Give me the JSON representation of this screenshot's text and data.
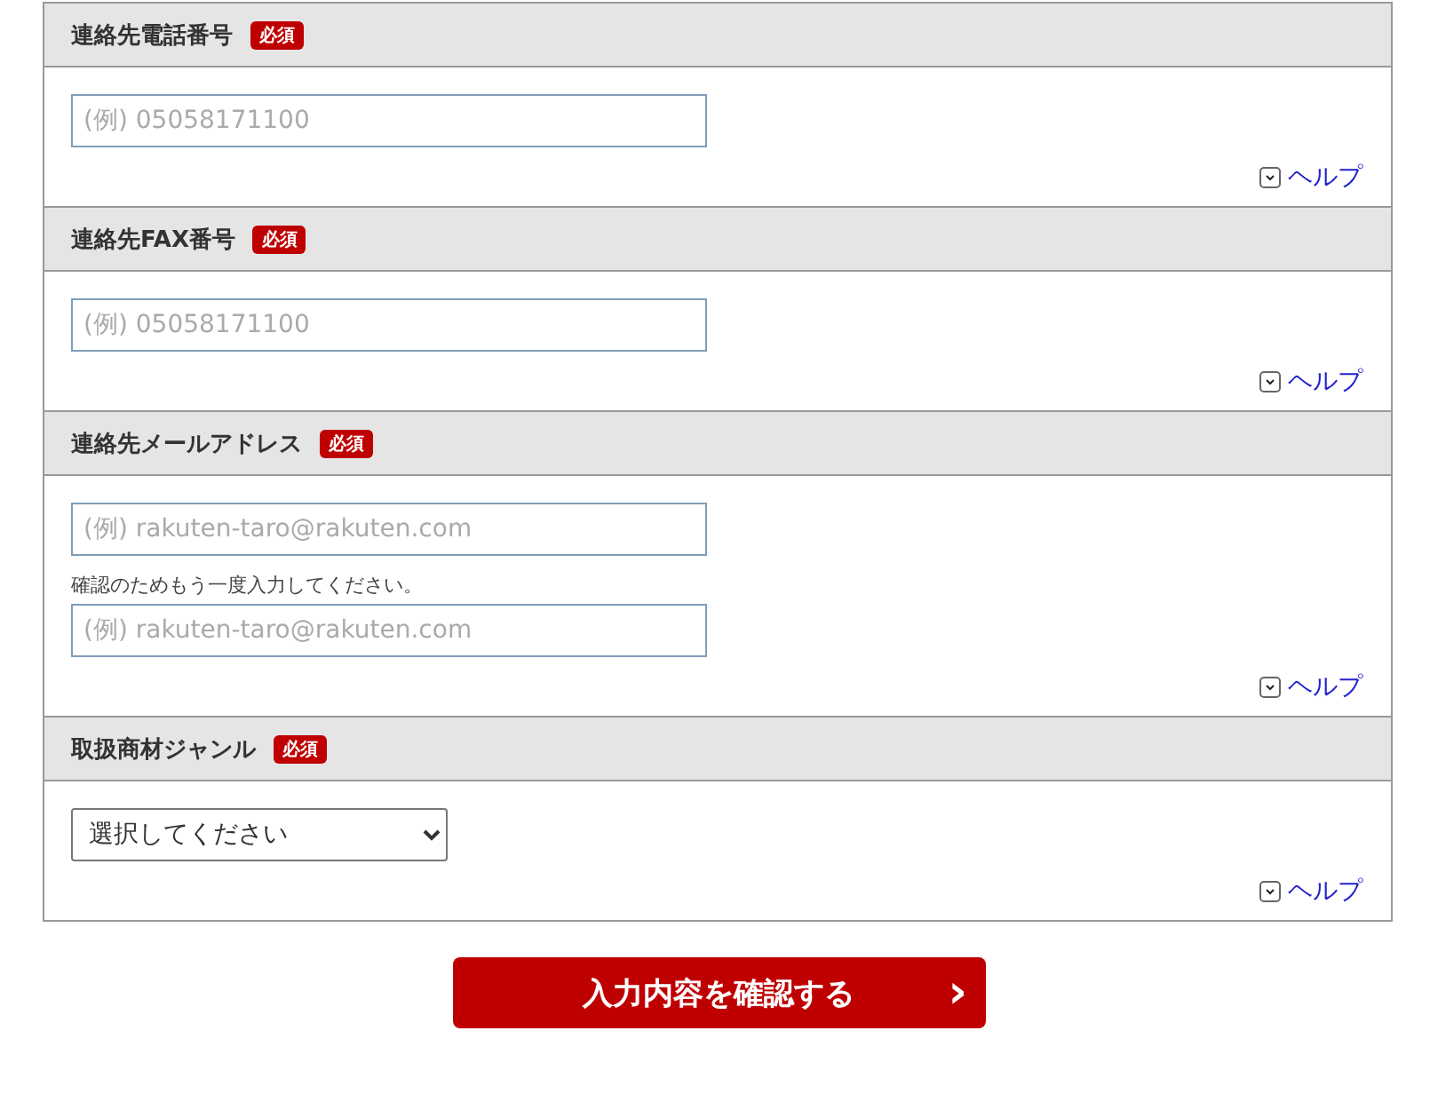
{
  "sections": [
    {
      "label": "連絡先電話番号",
      "badge": "必須",
      "fields": [
        {
          "kind": "input",
          "placeholder": "(例) 05058171100"
        }
      ],
      "help": "ヘルプ"
    },
    {
      "label": "連絡先FAX番号",
      "badge": "必須",
      "fields": [
        {
          "kind": "input",
          "placeholder": "(例) 05058171100"
        }
      ],
      "help": "ヘルプ"
    },
    {
      "label": "連絡先メールアドレス",
      "badge": "必須",
      "fields": [
        {
          "kind": "input",
          "placeholder": "(例) rakuten-taro@rakuten.com"
        },
        {
          "kind": "note",
          "text": "確認のためもう一度入力してください。"
        },
        {
          "kind": "input",
          "placeholder": "(例) rakuten-taro@rakuten.com"
        }
      ],
      "help": "ヘルプ"
    },
    {
      "label": "取扱商材ジャンル",
      "badge": "必須",
      "fields": [
        {
          "kind": "select",
          "value": "選択してください"
        }
      ],
      "help": "ヘルプ"
    }
  ],
  "submit": {
    "label": "入力内容を確認する",
    "arrow": "›"
  }
}
